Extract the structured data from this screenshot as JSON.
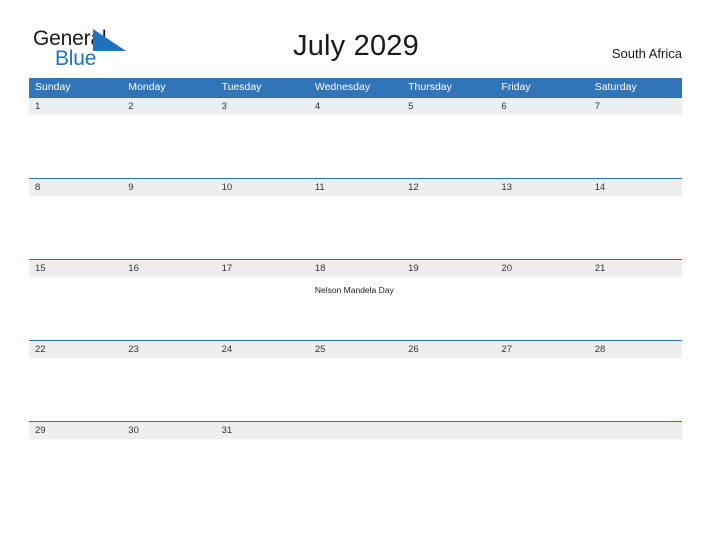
{
  "brand": {
    "name_part1": "General",
    "name_part2": "Blue",
    "flag_icon": "blue-triangle-flag-icon",
    "accent_color": "#1f72bd"
  },
  "header": {
    "title": "July 2029",
    "region": "South Africa"
  },
  "theme": {
    "header_blue": "#3175b8",
    "row_divider_blue": "#2c6fb0",
    "date_band_gray": "#eeeeee",
    "page_background": "#fdfdfd"
  },
  "calendar": {
    "weekdays": [
      "Sunday",
      "Monday",
      "Tuesday",
      "Wednesday",
      "Thursday",
      "Friday",
      "Saturday"
    ],
    "weeks": [
      {
        "short": false,
        "days": [
          {
            "num": "1",
            "event": ""
          },
          {
            "num": "2",
            "event": ""
          },
          {
            "num": "3",
            "event": ""
          },
          {
            "num": "4",
            "event": ""
          },
          {
            "num": "5",
            "event": ""
          },
          {
            "num": "6",
            "event": ""
          },
          {
            "num": "7",
            "event": ""
          }
        ]
      },
      {
        "short": false,
        "days": [
          {
            "num": "8",
            "event": ""
          },
          {
            "num": "9",
            "event": ""
          },
          {
            "num": "10",
            "event": ""
          },
          {
            "num": "11",
            "event": ""
          },
          {
            "num": "12",
            "event": ""
          },
          {
            "num": "13",
            "event": ""
          },
          {
            "num": "14",
            "event": ""
          }
        ]
      },
      {
        "short": false,
        "days": [
          {
            "num": "15",
            "event": ""
          },
          {
            "num": "16",
            "event": ""
          },
          {
            "num": "17",
            "event": ""
          },
          {
            "num": "18",
            "event": "Nelson Mandela Day"
          },
          {
            "num": "19",
            "event": ""
          },
          {
            "num": "20",
            "event": ""
          },
          {
            "num": "21",
            "event": ""
          }
        ]
      },
      {
        "short": false,
        "days": [
          {
            "num": "22",
            "event": ""
          },
          {
            "num": "23",
            "event": ""
          },
          {
            "num": "24",
            "event": ""
          },
          {
            "num": "25",
            "event": ""
          },
          {
            "num": "26",
            "event": ""
          },
          {
            "num": "27",
            "event": ""
          },
          {
            "num": "28",
            "event": ""
          }
        ]
      },
      {
        "short": true,
        "days": [
          {
            "num": "29",
            "event": ""
          },
          {
            "num": "30",
            "event": ""
          },
          {
            "num": "31",
            "event": ""
          },
          {
            "num": "",
            "event": ""
          },
          {
            "num": "",
            "event": ""
          },
          {
            "num": "",
            "event": ""
          },
          {
            "num": "",
            "event": ""
          }
        ]
      }
    ]
  }
}
